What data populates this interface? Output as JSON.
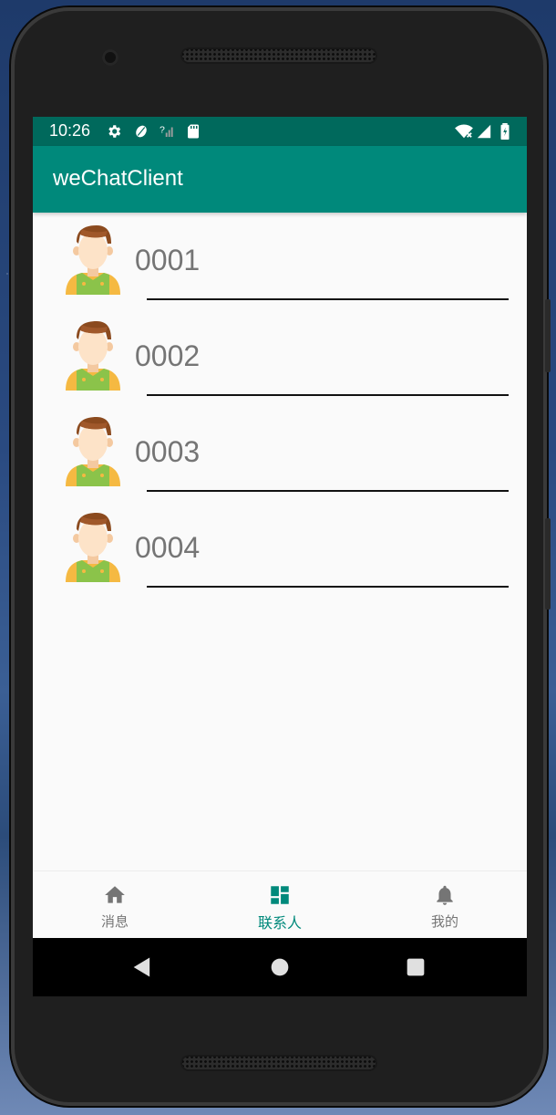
{
  "status_bar": {
    "time": "10:26"
  },
  "app_bar": {
    "title": "weChatClient"
  },
  "contacts": [
    {
      "name": "0001"
    },
    {
      "name": "0002"
    },
    {
      "name": "0003"
    },
    {
      "name": "0004"
    }
  ],
  "bottom_nav": {
    "items": [
      {
        "label": "消息",
        "icon": "home-icon",
        "active": false
      },
      {
        "label": "联系人",
        "icon": "dashboard-icon",
        "active": true
      },
      {
        "label": "我的",
        "icon": "bell-icon",
        "active": false
      }
    ]
  },
  "system_nav": {
    "buttons": [
      "back-icon",
      "home-circle-icon",
      "recents-square-icon"
    ]
  },
  "colors": {
    "status_bar": "#00695c",
    "app_bar": "#00897b",
    "accent": "#00897b",
    "inactive": "#757575"
  }
}
